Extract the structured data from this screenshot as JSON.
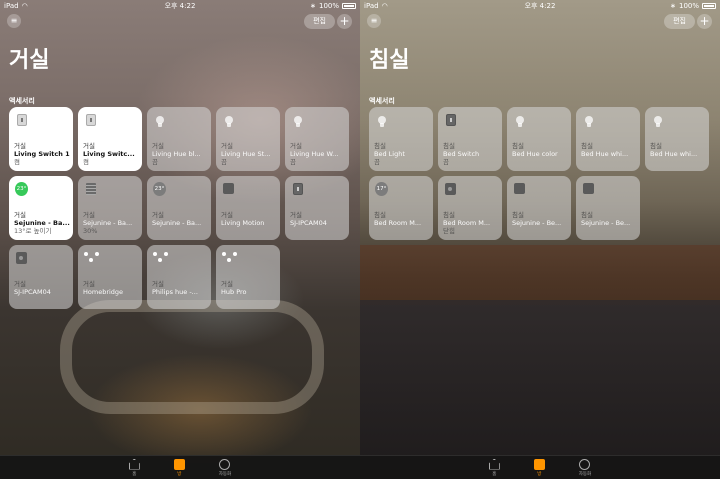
{
  "status": {
    "device": "iPad",
    "time": "오후 4:22",
    "battery": "100%"
  },
  "header": {
    "edit_label": "편집",
    "add_label": "+"
  },
  "section_label": "액세서리",
  "tabs": [
    {
      "label": "홈",
      "icon": "house-icon"
    },
    {
      "label": "방",
      "icon": "rooms-icon",
      "active": true
    },
    {
      "label": "자동화",
      "icon": "clock-icon"
    }
  ],
  "screens": [
    {
      "title": "거실",
      "tiles": [
        {
          "room": "거실",
          "name": "Living Switch 1",
          "status": "켬",
          "on": true,
          "icon": "switch"
        },
        {
          "room": "거실",
          "name": "Living Switc...",
          "status": "켬",
          "on": true,
          "icon": "switch"
        },
        {
          "room": "거실",
          "name": "Living Hue bl...",
          "status": "끔",
          "icon": "bulb"
        },
        {
          "room": "거실",
          "name": "Living Hue St...",
          "status": "끔",
          "icon": "bulb"
        },
        {
          "room": "거실",
          "name": "Living Hue W...",
          "status": "끔",
          "icon": "bulb"
        },
        {
          "room": "거실",
          "name": "Sejunine - Ba...",
          "status": "13°로 높이기",
          "on": true,
          "icon": "temp",
          "temp": "23°"
        },
        {
          "room": "거실",
          "name": "Sejunine - Ba...",
          "status": "30%",
          "icon": "blind"
        },
        {
          "room": "거실",
          "name": "Sejunine - Ba...",
          "status": "",
          "icon": "temp",
          "temp": "23°"
        },
        {
          "room": "거실",
          "name": "Living Motion",
          "status": "",
          "icon": "motion"
        },
        {
          "room": "거실",
          "name": "SJ-IPCAM04",
          "status": "",
          "icon": "switch-dim"
        },
        {
          "room": "거실",
          "name": "SJ-IPCAM04",
          "status": "",
          "icon": "cam"
        },
        {
          "room": "거실",
          "name": "Homebridge",
          "status": "",
          "icon": "bridge"
        },
        {
          "room": "거실",
          "name": "Philips hue -...",
          "status": "",
          "icon": "bridge"
        },
        {
          "room": "거실",
          "name": "Hub Pro",
          "status": "",
          "icon": "bridge"
        }
      ]
    },
    {
      "title": "침실",
      "tiles": [
        {
          "room": "침실",
          "name": "Bed Light",
          "status": "끔",
          "icon": "bulb"
        },
        {
          "room": "침실",
          "name": "Bed Switch",
          "status": "끔",
          "icon": "switch-dim"
        },
        {
          "room": "침실",
          "name": "Bed Hue color",
          "status": "",
          "icon": "bulb"
        },
        {
          "room": "침실",
          "name": "Bed Hue whi...",
          "status": "",
          "icon": "bulb"
        },
        {
          "room": "침실",
          "name": "Bed Hue whi...",
          "status": "",
          "icon": "bulb"
        },
        {
          "room": "침실",
          "name": "Bed Room M...",
          "status": "",
          "icon": "temp",
          "temp": "17°"
        },
        {
          "room": "침실",
          "name": "Bed Room M...",
          "status": "닫힘",
          "icon": "cam"
        },
        {
          "room": "침실",
          "name": "Sejunine - Be...",
          "status": "",
          "icon": "motion"
        },
        {
          "room": "침실",
          "name": "Sejunine - Be...",
          "status": "",
          "icon": "motion"
        }
      ]
    }
  ]
}
